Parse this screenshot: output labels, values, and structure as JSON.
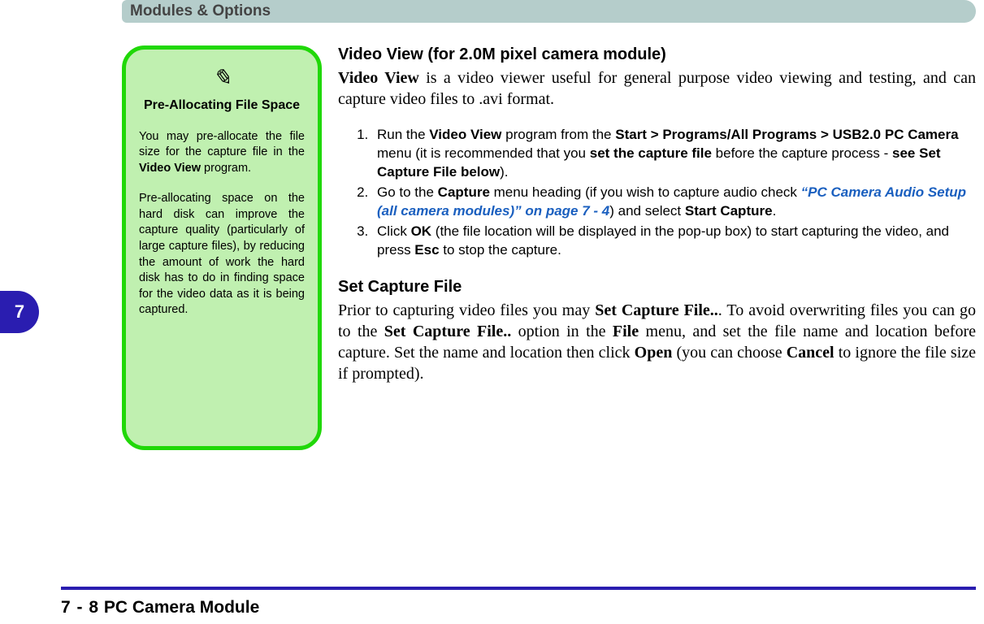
{
  "header": {
    "title": "Modules & Options"
  },
  "chapter_tab": "7",
  "sidebar": {
    "icon": "✎",
    "heading": "Pre-Allocating File Space",
    "para1_html": "You may pre-allocate the file size for the capture file in the <b>Video View</b> program.",
    "para2": "Pre-allocating space on the hard disk can improve the capture quality (particularly of large capture files), by reducing the amount of work the hard disk has to do in finding space for the video data as it is being captured."
  },
  "main": {
    "h1": "Video View (for 2.0M pixel camera module)",
    "intro_html": "<b>Video View</b> is a video viewer useful for general purpose video viewing and testing, and can capture video files to .avi format.",
    "steps": [
      "Run the <b>Video View</b> program from the <b>Start &gt; Programs/All Programs &gt; USB2.0 PC Camera</b> menu (it is recommended that you <b>set the capture file</b> before the capture process - <b>see Set Capture File below</b>).",
      "Go to the <b>Capture</b> menu heading (if you wish to capture audio check <span class=\"xref\">&ldquo;PC Camera Audio Setup (all camera modules)&rdquo; on page 7 - 4</span>) and select <b>Start Capture</b>.",
      "Click <b>OK</b> (the file location will be displayed in the pop-up box) to start capturing the video, and press <b>Esc</b> to stop the capture."
    ],
    "h2": "Set Capture File",
    "p2_html": "Prior to capturing video files you may <b>Set Capture File..</b>. To avoid overwriting files you can go to the <b>Set Capture File..</b> option in the <b>File</b> menu, and set the file name and location before capture. Set the name and location then click <b>Open</b> (you can choose <b>Cancel</b> to ignore the file size if prompted)."
  },
  "footer": {
    "page": "7 - 8",
    "title": "PC Camera Module"
  }
}
